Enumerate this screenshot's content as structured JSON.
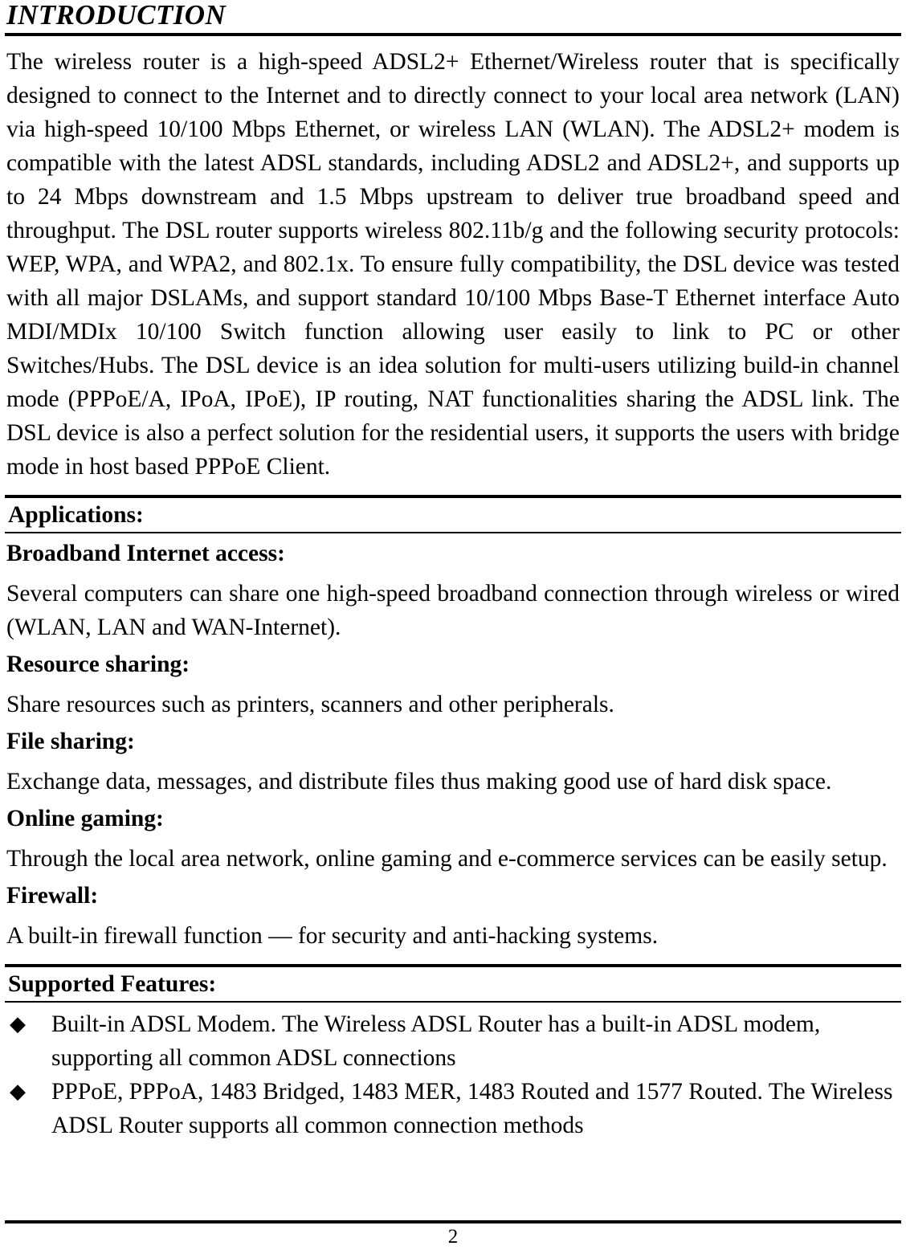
{
  "document": {
    "title": "INTRODUCTION",
    "page_number": "2"
  },
  "intro": {
    "paragraph": "The wireless router is a high-speed ADSL2+ Ethernet/Wireless router that is specifically designed to connect to the Internet and to directly connect to your local area network (LAN) via high-speed 10/100 Mbps Ethernet, or wireless LAN (WLAN). The ADSL2+ modem is compatible with the latest ADSL standards, including ADSL2 and ADSL2+, and supports up to 24 Mbps downstream and 1.5 Mbps upstream to deliver true broadband speed and throughput. The DSL router supports wireless 802.11b/g and the following security protocols: WEP, WPA, and WPA2, and 802.1x. To ensure fully compatibility, the DSL device was tested with all major DSLAMs, and support standard 10/100 Mbps Base-T Ethernet interface Auto MDI/MDIx 10/100 Switch function allowing user easily to link to PC or other Switches/Hubs. The DSL device is an idea solution for multi-users utilizing build-in channel mode (PPPoE/A, IPoA, IPoE), IP routing, NAT functionalities sharing the ADSL link. The DSL device is also a perfect solution for the residential users, it supports the users with bridge mode in host based PPPoE Client."
  },
  "applications": {
    "heading": "Applications:",
    "items": [
      {
        "title": "Broadband Internet access:",
        "text": "Several computers can share one high-speed broadband connection through wireless or wired (WLAN, LAN and WAN-Internet)."
      },
      {
        "title": "Resource sharing:",
        "text": "Share resources such as printers, scanners and other peripherals."
      },
      {
        "title": "File sharing:",
        "text": "Exchange data, messages, and distribute files thus making good use of hard disk space."
      },
      {
        "title": "Online gaming:",
        "text": "Through the local area network, online gaming and e-commerce services can be easily setup."
      },
      {
        "title": "Firewall:",
        "text": "A built-in firewall function — for security and anti-hacking systems."
      }
    ]
  },
  "supported_features": {
    "heading": "Supported Features:",
    "bullet_glyph": "◆",
    "bullets": [
      "Built-in ADSL Modem. The Wireless ADSL Router has a built-in ADSL modem, supporting all common ADSL connections",
      "PPPoE, PPPoA, 1483 Bridged, 1483 MER, 1483 Routed and 1577 Routed. The Wireless ADSL Router supports all common connection methods"
    ]
  }
}
